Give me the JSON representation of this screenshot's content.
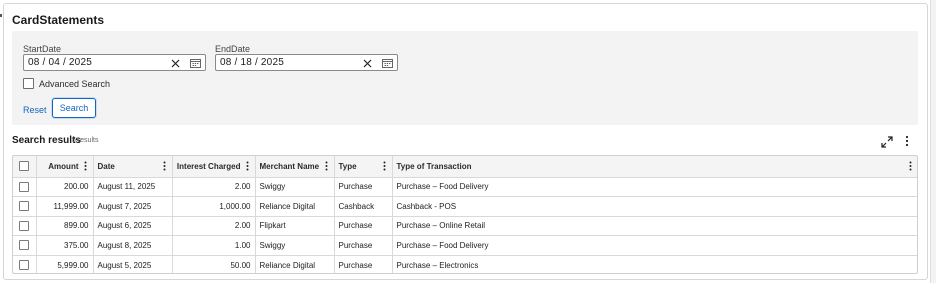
{
  "card": {
    "title": "CardStatements"
  },
  "filters": {
    "start_date": {
      "label": "StartDate",
      "value": "08 / 04 / 2025"
    },
    "end_date": {
      "label": "EndDate",
      "value": "08 / 18 / 2025"
    },
    "advanced_search": {
      "label": "Advanced Search",
      "checked": false
    },
    "reset_label": "Reset",
    "search_label": "Search"
  },
  "results": {
    "title": "Search results",
    "count_text": "5 results"
  },
  "table": {
    "columns": [
      "Amount",
      "Date",
      "Interest Charged",
      "Merchant Name",
      "Type",
      "Type of Transaction"
    ],
    "rows": [
      [
        "200.00",
        "August 11, 2025",
        "2.00",
        "Swiggy",
        "Purchase",
        "Purchase – Food Delivery"
      ],
      [
        "11,999.00",
        "August 7, 2025",
        "1,000.00",
        "Reliance Digital",
        "Cashback",
        "Cashback - POS"
      ],
      [
        "899.00",
        "August 6, 2025",
        "2.00",
        "Flipkart",
        "Purchase",
        "Purchase – Online Retail"
      ],
      [
        "375.00",
        "August 8, 2025",
        "1.00",
        "Swiggy",
        "Purchase",
        "Purchase – Food Delivery"
      ],
      [
        "5,999.00",
        "August 5, 2025",
        "50.00",
        "Reliance Digital",
        "Purchase",
        "Purchase – Electronics"
      ]
    ]
  },
  "colors": {
    "accent": "#1565c0",
    "panel": "#f3f3f3",
    "border": "#d6d6d6"
  },
  "icons": {
    "clear": "close-icon",
    "calendar": "calendar-icon",
    "expand": "expand-icon",
    "more": "more-vertical-icon"
  }
}
